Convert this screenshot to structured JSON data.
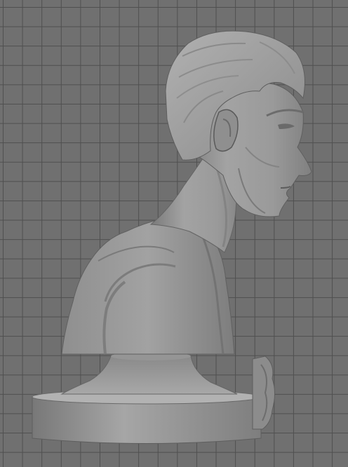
{
  "viewport": {
    "background_color": "#707070",
    "grid_line_color": "#4f4f4f",
    "model_color": "#9a9a9a",
    "grid_visible": true,
    "view": "side"
  },
  "model": {
    "subject": "bust",
    "has_base": true
  }
}
